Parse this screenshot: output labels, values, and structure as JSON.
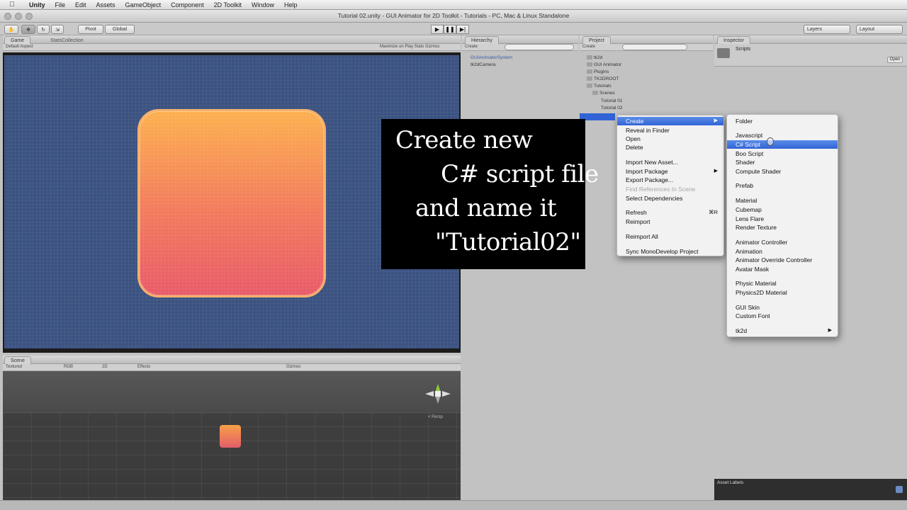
{
  "menubar": {
    "items": [
      "Unity",
      "File",
      "Edit",
      "Assets",
      "GameObject",
      "Component",
      "2D Toolkit",
      "Window",
      "Help"
    ]
  },
  "window": {
    "title": "Tutorial 02.unity - GUI Animator for 2D Toolkit - Tutorials - PC, Mac & Linux Standalone"
  },
  "toolbar": {
    "pivot_label": "Pivot",
    "global_label": "Global",
    "layers_label": "Layers",
    "layout_label": "Layout"
  },
  "game_panel": {
    "tabs": [
      "Game",
      "StatsCollection"
    ],
    "aspect": "Default Aspect",
    "options": "Maximize on Play   Stats   Gizmos"
  },
  "scene_panel": {
    "tab": "Scene",
    "shading": "Textured",
    "render": "RGB",
    "mode_2d": "2D",
    "effects": "Effects",
    "gizmos": "Gizmos",
    "persp": "< Persp"
  },
  "hierarchy": {
    "tab": "Hierarchy",
    "create": "Create",
    "items": [
      "GUIAnimatorSystem",
      "tk2dCamera"
    ]
  },
  "project": {
    "tab": "Project",
    "create": "Create",
    "items": [
      "tk2d",
      "GUI Animator",
      "Plugins",
      "TK2DROOT",
      "Tutorials",
      "Scenes",
      "Tutorial 01",
      "Tutorial 02"
    ]
  },
  "inspector": {
    "tab": "Inspector",
    "name": "Scripts",
    "open_button": "Open",
    "asset_labels": "Asset Labels"
  },
  "caption": {
    "lines": [
      "Create new",
      "C# script file",
      "and name it",
      "\"Tutorial02\""
    ]
  },
  "context_menu": {
    "items": [
      {
        "label": "Create",
        "submenu": true,
        "highlighted": true
      },
      {
        "label": "Reveal in Finder"
      },
      {
        "label": "Open"
      },
      {
        "label": "Delete"
      },
      {
        "label": "Import New Asset..."
      },
      {
        "label": "Import Package",
        "submenu": true
      },
      {
        "label": "Export Package..."
      },
      {
        "label": "Find References In Scene",
        "disabled": true
      },
      {
        "label": "Select Dependencies"
      },
      {
        "label": "Refresh",
        "shortcut": "⌘R"
      },
      {
        "label": "Reimport"
      },
      {
        "label": "Reimport All"
      },
      {
        "label": "Sync MonoDevelop Project"
      }
    ]
  },
  "create_submenu": {
    "items": [
      {
        "label": "Folder"
      },
      {
        "label": "Javascript"
      },
      {
        "label": "C# Script",
        "highlighted": true
      },
      {
        "label": "Boo Script"
      },
      {
        "label": "Shader"
      },
      {
        "label": "Compute Shader"
      },
      {
        "label": "Prefab"
      },
      {
        "label": "Material"
      },
      {
        "label": "Cubemap"
      },
      {
        "label": "Lens Flare"
      },
      {
        "label": "Render Texture"
      },
      {
        "label": "Animator Controller"
      },
      {
        "label": "Animation"
      },
      {
        "label": "Animator Override Controller"
      },
      {
        "label": "Avatar Mask"
      },
      {
        "label": "Physic Material"
      },
      {
        "label": "Physics2D Material"
      },
      {
        "label": "GUI Skin"
      },
      {
        "label": "Custom Font"
      },
      {
        "label": "tk2d",
        "submenu": true
      }
    ]
  },
  "colors": {
    "highlight": "#3163d6",
    "game_background": "#3b5281",
    "gui_gradient_top": "#fdb04f",
    "gui_gradient_bottom": "#e95b68"
  }
}
